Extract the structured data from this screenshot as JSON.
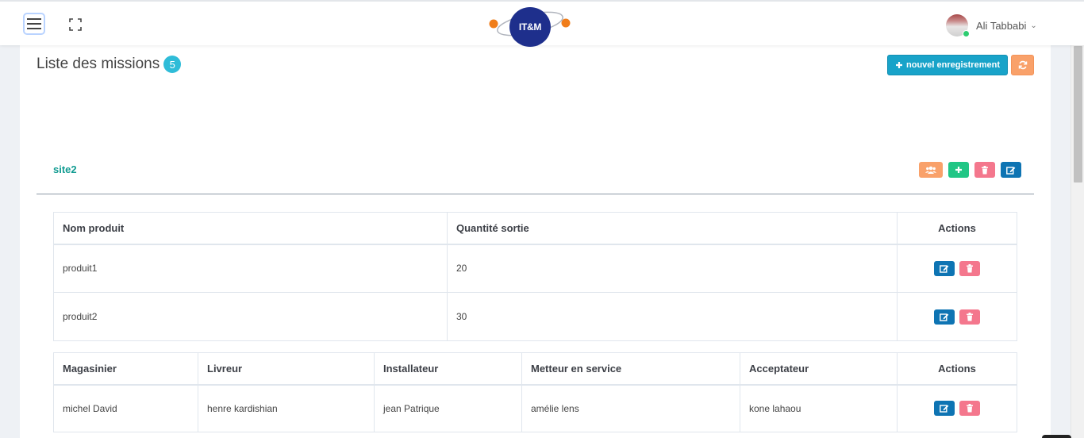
{
  "header": {
    "logo_text": "IT&M",
    "user_name": "Ali Tabbabi"
  },
  "page": {
    "title": "Liste des missions",
    "count": "5",
    "new_button_label": "nouvel enregistrement"
  },
  "site": {
    "name": "site2"
  },
  "products_table": {
    "headers": [
      "Nom produit",
      "Quantité sortie",
      "Actions"
    ],
    "rows": [
      {
        "name": "produit1",
        "quantity": "20"
      },
      {
        "name": "produit2",
        "quantity": "30"
      }
    ]
  },
  "staff_table": {
    "headers": [
      "Magasinier",
      "Livreur",
      "Installateur",
      "Metteur en service",
      "Acceptateur",
      "Actions"
    ],
    "rows": [
      {
        "magasinier": "michel David",
        "livreur": "henre kardishian",
        "installateur": "jean Patrique",
        "metteur": "amélie lens",
        "acceptateur": "kone lahaou"
      }
    ]
  },
  "colors": {
    "primary_blue": "#0e74b3",
    "info_cyan": "#18a3c9",
    "warning_orange": "#f9a16a",
    "success_green": "#21c685",
    "danger_red": "#f4778d",
    "site_title_teal": "#119b91",
    "logo_navy": "#1e2f8c"
  },
  "icons": [
    "menu-icon",
    "fullscreen-icon",
    "chevron-down-icon",
    "plus-icon",
    "refresh-icon",
    "users-icon",
    "trash-icon",
    "edit-icon"
  ]
}
